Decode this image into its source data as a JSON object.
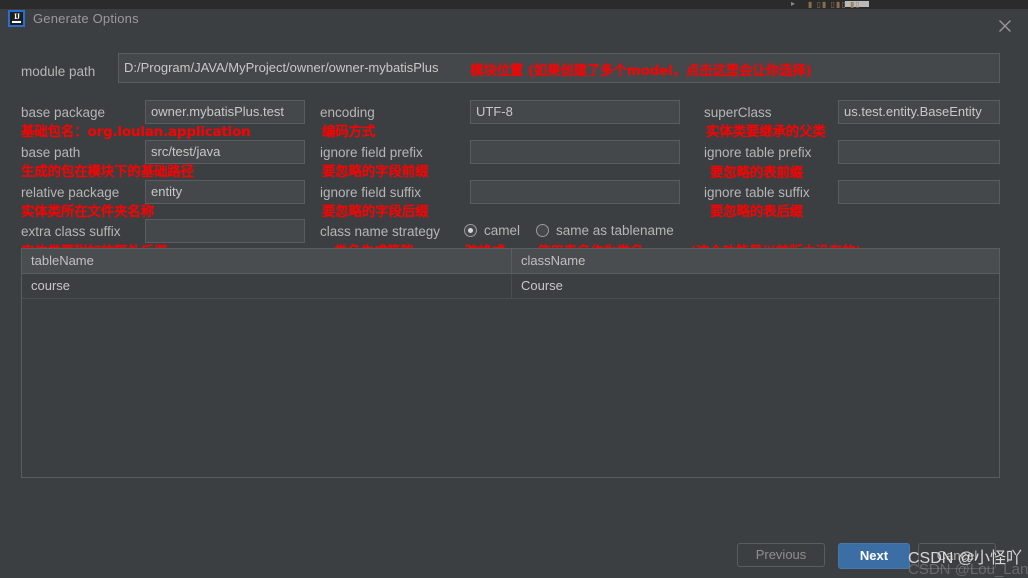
{
  "window": {
    "title": "Generate Options",
    "app_icon": "intellij-idea-icon",
    "close_icon": "close-icon"
  },
  "form": {
    "module_path": {
      "label": "module path",
      "value": "D:/Program/JAVA/MyProject/owner/owner-mybatisPlus",
      "annotation": "模块位置 (如果创建了多个model，点击这里会让你选择)"
    },
    "base_package": {
      "label": "base package",
      "value": "owner.mybatisPlus.test",
      "annotation": "基础包名：org.loulan.application"
    },
    "base_path": {
      "label": "base path",
      "value": "src/test/java",
      "annotation": "生成的包在模块下的基础路径"
    },
    "relative_package": {
      "label": "relative package",
      "value": "entity",
      "annotation": "实体类所在文件夹名称"
    },
    "extra_class_suffix": {
      "label": "extra class suffix",
      "value": "",
      "annotation": "实体类要附加的额外后缀"
    },
    "encoding": {
      "label": "encoding",
      "value": "UTF-8",
      "annotation": "编码方式"
    },
    "ignore_field_prefix": {
      "label": "ignore field prefix",
      "value": "",
      "annotation": "要忽略的字段前缀"
    },
    "ignore_field_suffix": {
      "label": "ignore field suffix",
      "value": "",
      "annotation": "要忽略的字段后缀"
    },
    "class_name_strategy": {
      "label": "class name strategy",
      "annotation": "类名生成策略",
      "options": [
        {
          "label": "camel",
          "selected": true,
          "annotation": "驼峰式"
        },
        {
          "label": "same as tablename",
          "selected": false,
          "annotation": "使用表名作为类名"
        }
      ],
      "extra_annotation": "(这个功能是以前版本没有的)"
    },
    "super_class": {
      "label": "superClass",
      "value": "us.test.entity.BaseEntity",
      "annotation": "实体类要继承的父类"
    },
    "ignore_table_prefix": {
      "label": "ignore table prefix",
      "value": "",
      "annotation": "要忽略的表前缀"
    },
    "ignore_table_suffix": {
      "label": "ignore table suffix",
      "value": "",
      "annotation": "要忽略的表后缀"
    }
  },
  "table": {
    "columns": [
      "tableName",
      "className"
    ],
    "rows": [
      {
        "tableName": "course",
        "className": "Course"
      }
    ]
  },
  "footer": {
    "previous_label": "Previous",
    "next_label": "Next",
    "cancel_label": "Cancel"
  },
  "watermark": {
    "primary": "CSDN @小怪吖",
    "secondary": "CSDN @Lou_Lan"
  },
  "colors": {
    "dialog_background": "#3c3f41",
    "field_background": "#45484a",
    "annotation_red": "#ff0000",
    "primary_button": "#3b6ea5",
    "icon_accent": "#2a6fc9"
  }
}
